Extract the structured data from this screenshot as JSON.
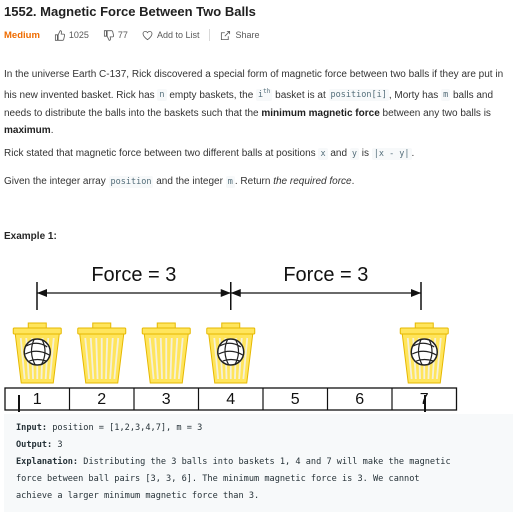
{
  "problem": {
    "title": "1552. Magnetic Force Between Two Balls",
    "difficulty": "Medium",
    "likes": "1025",
    "dislikes": "77",
    "add_to_list": "Add to List",
    "share": "Share"
  },
  "description": {
    "p1_a": "In the universe Earth C-137, Rick discovered a special form of magnetic force between two balls if they are put in his new invented basket. Rick has ",
    "p1_n": "n",
    "p1_b": " empty baskets, the ",
    "p1_i": "i",
    "p1_th": "th",
    "p1_c": " basket is at ",
    "p1_pos": "position[i]",
    "p1_d": ", Morty has ",
    "p1_m": "m",
    "p1_e": " balls and needs to distribute the balls into the baskets such that the ",
    "p1_bold1": "minimum magnetic force",
    "p1_f": " between any two balls is ",
    "p1_bold2": "maximum",
    "p1_g": ".",
    "p2_a": "Rick stated that magnetic force between two different balls at positions ",
    "p2_x": "x",
    "p2_and": " and ",
    "p2_y": "y",
    "p2_is": " is ",
    "p2_formula": "|x - y|",
    "p2_end": ".",
    "p3_a": "Given the integer array ",
    "p3_position": "position",
    "p3_b": " and the integer ",
    "p3_m": "m",
    "p3_c": ". Return ",
    "p3_em": "the required force",
    "p3_d": "."
  },
  "example": {
    "title": "Example 1:",
    "diagram": {
      "force_labels": [
        "Force = 3",
        "Force = 3"
      ],
      "slots": [
        "1",
        "2",
        "3",
        "4",
        "5",
        "6",
        "7"
      ],
      "ball_positions": [
        1,
        4,
        7
      ],
      "empty_basket_positions": [
        2,
        3
      ]
    },
    "input_label": "Input:",
    "input_value": " position = [1,2,3,4,7], m = 3",
    "output_label": "Output:",
    "output_value": " 3",
    "explanation_label": "Explanation:",
    "explanation_line1": " Distributing the 3 balls into baskets 1, 4 and 7 will make the magnetic",
    "explanation_line2": "force between ball pairs [3, 3, 6]. The minimum magnetic force is 3. We cannot",
    "explanation_line3": "achieve a larger minimum magnetic force than 3."
  },
  "colors": {
    "difficulty": "#ef6c00",
    "basket": "#ffe55c",
    "basket_stroke": "#e6b800"
  }
}
